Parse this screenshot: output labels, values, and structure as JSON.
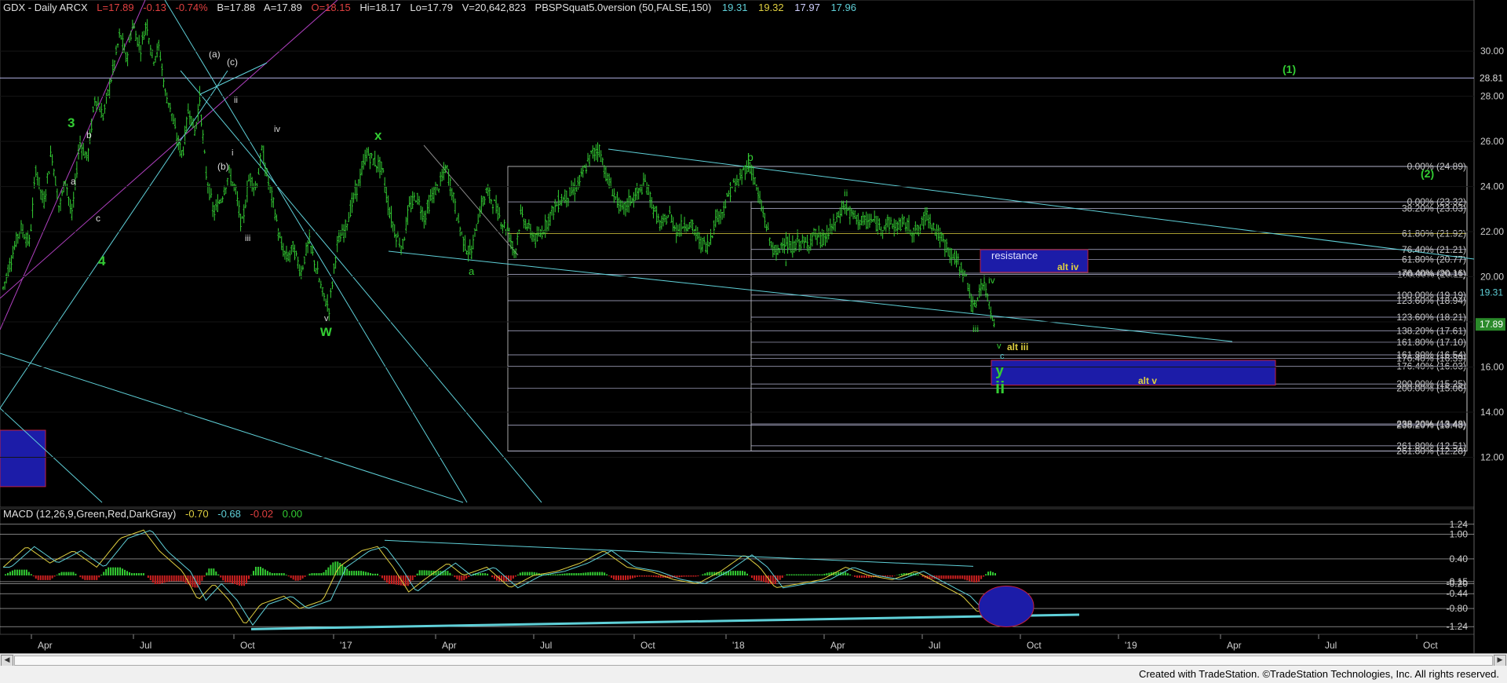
{
  "header": {
    "symbol": "GDX - Daily  ARCX",
    "last": "L=17.89",
    "change": "-0.13",
    "change_pct": "-0.74%",
    "bid": "B=17.88",
    "ask": "A=17.89",
    "open": "O=18.15",
    "high": "Hi=18.17",
    "low": "Lo=17.79",
    "volume": "V=20,642,823",
    "study": "PBSPSquat5.0version (50,FALSE,150)",
    "study_values": [
      "19.31",
      "19.32",
      "17.97",
      "17.96"
    ]
  },
  "macd_header": {
    "label": "MACD (12,26,9,Green,Red,DarkGray)",
    "values": [
      "-0.70",
      "-0.68",
      "-0.02",
      "0.00"
    ]
  },
  "credit": "Created with TradeStation. ©TradeStation Technologies, Inc. All rights reserved.",
  "colors": {
    "up": "#33cc33",
    "down": "#cc2020",
    "cyan": "#5fd0d8",
    "yellow": "#e0d040",
    "magenta": "#b040c0",
    "box_blue": "#1c1ca8",
    "white": "#e8e8e8",
    "gray": "#808080"
  },
  "chart_data": [
    {
      "type": "candlestick",
      "title": "GDX - Daily ARCX",
      "x_tick_labels": [
        "Apr",
        "Jul",
        "Oct",
        "'17",
        "Apr",
        "Jul",
        "Oct",
        "'18",
        "Apr",
        "Jul",
        "Oct",
        "'19",
        "Apr",
        "Jul",
        "Oct"
      ],
      "y_tick_labels": [
        "12.00",
        "14.00",
        "16.00",
        "18.00",
        "20.00",
        "22.00",
        "24.00",
        "26.00",
        "28.00",
        "30.00"
      ],
      "ylim": [
        10.0,
        31.5
      ],
      "last_price": "17.89",
      "side_prices": [
        {
          "label": "28.81",
          "value": 28.81
        },
        {
          "label": "17.89",
          "value": 17.89
        },
        {
          "label": "19.31",
          "value": 19.31
        }
      ],
      "price_path": [
        {
          "t": 0,
          "v": 19.5
        },
        {
          "t": 12,
          "v": 21.0
        },
        {
          "t": 22,
          "v": 22.2
        },
        {
          "t": 34,
          "v": 21.5
        },
        {
          "t": 42,
          "v": 24.8
        },
        {
          "t": 52,
          "v": 23.2
        },
        {
          "t": 62,
          "v": 25.6
        },
        {
          "t": 72,
          "v": 23.0
        },
        {
          "t": 80,
          "v": 24.4
        },
        {
          "t": 88,
          "v": 22.6
        },
        {
          "t": 98,
          "v": 26.0
        },
        {
          "t": 108,
          "v": 25.2
        },
        {
          "t": 118,
          "v": 28.0
        },
        {
          "t": 128,
          "v": 27.1
        },
        {
          "t": 140,
          "v": 29.0
        },
        {
          "t": 150,
          "v": 30.8
        },
        {
          "t": 158,
          "v": 29.6
        },
        {
          "t": 166,
          "v": 31.2
        },
        {
          "t": 176,
          "v": 30.1
        },
        {
          "t": 184,
          "v": 31.3
        },
        {
          "t": 192,
          "v": 29.6
        },
        {
          "t": 200,
          "v": 30.2
        },
        {
          "t": 208,
          "v": 28.1
        },
        {
          "t": 214,
          "v": 27.6
        },
        {
          "t": 222,
          "v": 26.2
        },
        {
          "t": 230,
          "v": 25.4
        },
        {
          "t": 238,
          "v": 27.5
        },
        {
          "t": 246,
          "v": 26.4
        },
        {
          "t": 252,
          "v": 27.9
        },
        {
          "t": 260,
          "v": 24.6
        },
        {
          "t": 270,
          "v": 22.8
        },
        {
          "t": 280,
          "v": 23.5
        },
        {
          "t": 290,
          "v": 24.6
        },
        {
          "t": 298,
          "v": 23.8
        },
        {
          "t": 306,
          "v": 22.2
        },
        {
          "t": 316,
          "v": 24.5
        },
        {
          "t": 324,
          "v": 23.9
        },
        {
          "t": 332,
          "v": 25.6
        },
        {
          "t": 340,
          "v": 24.2
        },
        {
          "t": 348,
          "v": 23.0
        },
        {
          "t": 356,
          "v": 21.4
        },
        {
          "t": 364,
          "v": 20.8
        },
        {
          "t": 372,
          "v": 21.3
        },
        {
          "t": 382,
          "v": 20.2
        },
        {
          "t": 392,
          "v": 21.6
        },
        {
          "t": 402,
          "v": 20.3
        },
        {
          "t": 410,
          "v": 19.2
        },
        {
          "t": 418,
          "v": 18.6
        },
        {
          "t": 428,
          "v": 21.4
        },
        {
          "t": 438,
          "v": 22.1
        },
        {
          "t": 448,
          "v": 23.3
        },
        {
          "t": 458,
          "v": 24.4
        },
        {
          "t": 466,
          "v": 25.5
        },
        {
          "t": 476,
          "v": 25.1
        },
        {
          "t": 486,
          "v": 24.8
        },
        {
          "t": 494,
          "v": 23.1
        },
        {
          "t": 502,
          "v": 22.0
        },
        {
          "t": 512,
          "v": 21.3
        },
        {
          "t": 520,
          "v": 23.0
        },
        {
          "t": 530,
          "v": 23.6
        },
        {
          "t": 540,
          "v": 22.6
        },
        {
          "t": 550,
          "v": 23.6
        },
        {
          "t": 560,
          "v": 24.1
        },
        {
          "t": 568,
          "v": 24.9
        },
        {
          "t": 576,
          "v": 23.7
        },
        {
          "t": 584,
          "v": 22.4
        },
        {
          "t": 592,
          "v": 21.4
        },
        {
          "t": 600,
          "v": 21.0
        },
        {
          "t": 610,
          "v": 22.8
        },
        {
          "t": 620,
          "v": 23.8
        },
        {
          "t": 630,
          "v": 23.2
        },
        {
          "t": 640,
          "v": 22.4
        },
        {
          "t": 648,
          "v": 22.0
        },
        {
          "t": 656,
          "v": 21.0
        },
        {
          "t": 664,
          "v": 22.8
        },
        {
          "t": 674,
          "v": 22.1
        },
        {
          "t": 684,
          "v": 21.6
        },
        {
          "t": 694,
          "v": 22.2
        },
        {
          "t": 704,
          "v": 22.9
        },
        {
          "t": 714,
          "v": 23.4
        },
        {
          "t": 724,
          "v": 23.6
        },
        {
          "t": 734,
          "v": 23.9
        },
        {
          "t": 744,
          "v": 24.6
        },
        {
          "t": 754,
          "v": 25.4
        },
        {
          "t": 764,
          "v": 25.7
        },
        {
          "t": 774,
          "v": 24.4
        },
        {
          "t": 784,
          "v": 23.6
        },
        {
          "t": 794,
          "v": 22.9
        },
        {
          "t": 804,
          "v": 23.4
        },
        {
          "t": 814,
          "v": 23.7
        },
        {
          "t": 824,
          "v": 24.2
        },
        {
          "t": 834,
          "v": 23.0
        },
        {
          "t": 844,
          "v": 22.2
        },
        {
          "t": 854,
          "v": 22.8
        },
        {
          "t": 864,
          "v": 22.0
        },
        {
          "t": 874,
          "v": 22.4
        },
        {
          "t": 884,
          "v": 22.2
        },
        {
          "t": 894,
          "v": 21.5
        },
        {
          "t": 904,
          "v": 21.4
        },
        {
          "t": 914,
          "v": 22.6
        },
        {
          "t": 924,
          "v": 23.0
        },
        {
          "t": 934,
          "v": 24.0
        },
        {
          "t": 944,
          "v": 24.2
        },
        {
          "t": 952,
          "v": 24.9
        },
        {
          "t": 960,
          "v": 24.8
        },
        {
          "t": 968,
          "v": 23.6
        },
        {
          "t": 976,
          "v": 22.6
        },
        {
          "t": 984,
          "v": 21.5
        },
        {
          "t": 992,
          "v": 20.9
        },
        {
          "t": 1000,
          "v": 21.7
        },
        {
          "t": 1010,
          "v": 21.2
        },
        {
          "t": 1020,
          "v": 21.6
        },
        {
          "t": 1030,
          "v": 21.4
        },
        {
          "t": 1040,
          "v": 21.9
        },
        {
          "t": 1050,
          "v": 21.6
        },
        {
          "t": 1060,
          "v": 22.0
        },
        {
          "t": 1070,
          "v": 22.6
        },
        {
          "t": 1078,
          "v": 23.2
        },
        {
          "t": 1086,
          "v": 22.8
        },
        {
          "t": 1094,
          "v": 22.6
        },
        {
          "t": 1104,
          "v": 22.4
        },
        {
          "t": 1114,
          "v": 22.5
        },
        {
          "t": 1124,
          "v": 22.2
        },
        {
          "t": 1134,
          "v": 22.4
        },
        {
          "t": 1144,
          "v": 22.2
        },
        {
          "t": 1154,
          "v": 22.4
        },
        {
          "t": 1164,
          "v": 22.1
        },
        {
          "t": 1174,
          "v": 22.0
        },
        {
          "t": 1184,
          "v": 22.8
        },
        {
          "t": 1192,
          "v": 22.3
        },
        {
          "t": 1200,
          "v": 21.8
        },
        {
          "t": 1210,
          "v": 21.3
        },
        {
          "t": 1220,
          "v": 20.8
        },
        {
          "t": 1230,
          "v": 20.3
        },
        {
          "t": 1238,
          "v": 19.6
        },
        {
          "t": 1244,
          "v": 18.4
        },
        {
          "t": 1248,
          "v": 18.9
        },
        {
          "t": 1254,
          "v": 19.7
        },
        {
          "t": 1260,
          "v": 19.4
        },
        {
          "t": 1266,
          "v": 18.6
        },
        {
          "t": 1272,
          "v": 17.9
        }
      ]
    },
    {
      "type": "line",
      "title": "MACD (12,26,9,Green,Red,DarkGray)",
      "y_tick_labels": [
        "1.24",
        "1.00",
        "0.40",
        "-0.15",
        "-0.20",
        "-0.44",
        "-0.80",
        "-1.24"
      ],
      "ylim": [
        -1.35,
        1.35
      ],
      "last_value": "-0.02",
      "series": [
        {
          "values_path": [
            {
              "t": 0,
              "v": 0.2
            },
            {
              "t": 30,
              "v": 0.7
            },
            {
              "t": 60,
              "v": 0.3
            },
            {
              "t": 90,
              "v": 0.6
            },
            {
              "t": 120,
              "v": 0.2
            },
            {
              "t": 150,
              "v": 0.9
            },
            {
              "t": 180,
              "v": 1.1
            },
            {
              "t": 200,
              "v": 0.6
            },
            {
              "t": 230,
              "v": 0.1
            },
            {
              "t": 250,
              "v": -0.6
            },
            {
              "t": 270,
              "v": -0.2
            },
            {
              "t": 290,
              "v": -0.6
            },
            {
              "t": 310,
              "v": -1.2
            },
            {
              "t": 330,
              "v": -0.7
            },
            {
              "t": 360,
              "v": -0.5
            },
            {
              "t": 380,
              "v": -0.8
            },
            {
              "t": 410,
              "v": -0.6
            },
            {
              "t": 430,
              "v": 0.2
            },
            {
              "t": 460,
              "v": 0.6
            },
            {
              "t": 480,
              "v": 0.7
            },
            {
              "t": 500,
              "v": 0.2
            },
            {
              "t": 520,
              "v": -0.4
            },
            {
              "t": 540,
              "v": -0.1
            },
            {
              "t": 570,
              "v": 0.3
            },
            {
              "t": 590,
              "v": 0.0
            },
            {
              "t": 620,
              "v": 0.2
            },
            {
              "t": 650,
              "v": -0.3
            },
            {
              "t": 680,
              "v": 0.0
            },
            {
              "t": 710,
              "v": 0.1
            },
            {
              "t": 740,
              "v": 0.3
            },
            {
              "t": 770,
              "v": 0.6
            },
            {
              "t": 800,
              "v": 0.2
            },
            {
              "t": 830,
              "v": 0.1
            },
            {
              "t": 860,
              "v": -0.1
            },
            {
              "t": 890,
              "v": -0.2
            },
            {
              "t": 920,
              "v": 0.1
            },
            {
              "t": 950,
              "v": 0.5
            },
            {
              "t": 970,
              "v": 0.2
            },
            {
              "t": 990,
              "v": -0.3
            },
            {
              "t": 1020,
              "v": -0.2
            },
            {
              "t": 1050,
              "v": -0.1
            },
            {
              "t": 1080,
              "v": 0.2
            },
            {
              "t": 1110,
              "v": 0.0
            },
            {
              "t": 1140,
              "v": -0.1
            },
            {
              "t": 1170,
              "v": 0.1
            },
            {
              "t": 1200,
              "v": -0.2
            },
            {
              "t": 1230,
              "v": -0.5
            },
            {
              "t": 1250,
              "v": -0.9
            },
            {
              "t": 1265,
              "v": -0.7
            },
            {
              "t": 1272,
              "v": -0.7
            }
          ]
        }
      ]
    }
  ],
  "fib_labels": [
    "0.00% (24.89)",
    "0.00% (23.32)",
    "38.20% (23.03)",
    "61.80% (21.92)",
    "76.40% (21.21)",
    "61.80% (20.77)",
    "76.40% (20.16)",
    "100.00% (20.11)",
    "100.00% (19.19)",
    "123.60% (18.94)",
    "123.60% (18.21)",
    "138.20% (17.61)",
    "161.80% (17.10)",
    "161.80% (16.54)",
    "176.40% (16.39)",
    "176.40% (16.03)",
    "200.00% (15.25)",
    "200.00% (15.06)",
    "238.20% (13.48)",
    "238.20% (13.43)",
    "261.80% (12.51)",
    "261.80% (12.28)"
  ],
  "annotations": {
    "wave_green": [
      "3",
      "4",
      "x",
      "w",
      "a",
      "ii",
      "y",
      "(1)",
      "(2)"
    ],
    "wave_white": [
      "b",
      "a",
      "c",
      "ii",
      "i",
      "iii",
      "iv",
      "v",
      "(a)",
      "(c)",
      "(b)"
    ],
    "wave_green_small": [
      "b",
      "ii",
      "i",
      "iii",
      "iv",
      "v",
      "c"
    ],
    "resistance": "resistance",
    "alt_iv": "alt iv",
    "alt_iii": "alt iii",
    "alt_v": "alt v"
  }
}
